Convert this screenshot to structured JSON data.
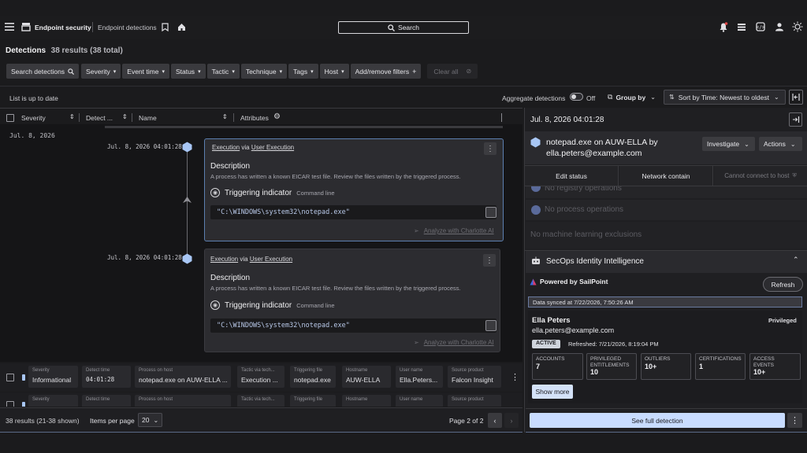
{
  "header": {
    "app_name": "Endpoint security",
    "section": "Endpoint detections",
    "search_label": "Search"
  },
  "title_bar": {
    "title": "Detections",
    "results": "38 results (38 total)"
  },
  "filters": {
    "search_detections": "Search detections",
    "severity": "Severity",
    "event_time": "Event time",
    "status": "Status",
    "tactic": "Tactic",
    "technique": "Technique",
    "tags": "Tags",
    "host": "Host",
    "add_remove": "Add/remove filters",
    "clear_all": "Clear all"
  },
  "toolbar": {
    "up_to_date": "List is up to date",
    "aggregate": "Aggregate detections",
    "aggregate_state": "Off",
    "group_by": "Group by",
    "sort_by": "Sort by Time: Newest to oldest"
  },
  "columns": {
    "severity": "Severity",
    "detect": "Detect ...",
    "name": "Name",
    "attributes": "Attributes"
  },
  "timeline": {
    "date": "Jul. 8, 2026",
    "events": [
      {
        "time": "Jul. 8, 2026 04:01:28",
        "technique": "Execution",
        "via": "via",
        "tactic": "User Execution",
        "desc_heading": "Description",
        "desc_text": "A process has written a known EICAR test file. Review the files written by the triggered process.",
        "indicator_label": "Triggering indicator",
        "indicator_type": "Command line",
        "command": "\"C:\\WINDOWS\\system32\\notepad.exe\"",
        "analyze": "Analyze with Charlotte AI"
      },
      {
        "time": "Jul. 8, 2026 04:01:28",
        "technique": "Execution",
        "via": "via",
        "tactic": "User Execution",
        "desc_heading": "Description",
        "desc_text": "A process has written a known EICAR test file. Review the files written by the triggered process.",
        "indicator_label": "Triggering indicator",
        "indicator_type": "Command line",
        "command": "\"C:\\WINDOWS\\system32\\notepad.exe\"",
        "analyze": "Analyze with Charlotte AI"
      }
    ]
  },
  "summary_row": {
    "cells": [
      {
        "k": "Severity",
        "v": "Informational"
      },
      {
        "k": "Detect time",
        "v": "04:01:28"
      },
      {
        "k": "Process on host",
        "v": "notepad.exe on AUW-ELLA ..."
      },
      {
        "k": "Tactic via tech...",
        "v": "Execution ..."
      },
      {
        "k": "Triggering file",
        "v": "notepad.exe"
      },
      {
        "k": "Hostname",
        "v": "AUW-ELLA"
      },
      {
        "k": "User name",
        "v": "Ella.Peters..."
      },
      {
        "k": "Source product",
        "v": "Falcon Insight"
      }
    ],
    "cells2": [
      {
        "k": "Severity"
      },
      {
        "k": "Detect time"
      },
      {
        "k": "Process on host"
      },
      {
        "k": "Tactic via tech..."
      },
      {
        "k": "Triggering file"
      },
      {
        "k": "Hostname"
      },
      {
        "k": "User name"
      },
      {
        "k": "Source product"
      }
    ]
  },
  "footer": {
    "shown": "38 results (21-38 shown)",
    "items_per_page": "Items per page",
    "per_page_value": "20",
    "page": "Page 2 of 2"
  },
  "panel": {
    "timestamp": "Jul. 8, 2026 04:01:28",
    "title_line1": "notepad.exe on AUW-ELLA by",
    "title_line2": "ella.peters@example.com",
    "investigate": "Investigate",
    "actions": "Actions",
    "edit_status": "Edit status",
    "network_contain": "Network contain",
    "cannot_connect": "Cannot connect to host",
    "no_registry": "No registry operations",
    "no_process": "No process operations",
    "no_ml": "No machine learning exclusions",
    "secops_title": "SecOps Identity Intelligence",
    "powered_by": "Powered by SailPoint",
    "refresh": "Refresh",
    "synced": "Data synced at 7/22/2026, 7:50:26 AM",
    "user_name": "Ella Peters",
    "user_email": "ella.peters@example.com",
    "privileged": "Privileged",
    "status_badge": "ACTIVE",
    "refreshed": "Refreshed: 7/21/2026, 8:19:04 PM",
    "stats": [
      {
        "k": "ACCOUNTS",
        "v": "7"
      },
      {
        "k": "PRIVILEGED ENTITLEMENTS",
        "v": "10"
      },
      {
        "k": "OUTLIERS",
        "v": "10+"
      },
      {
        "k": "CERTIFICATIONS",
        "v": "1"
      },
      {
        "k": "ACCESS EVENTS",
        "v": "10+"
      }
    ],
    "show_more": "Show more",
    "see_full": "See full detection"
  },
  "colors": {
    "accent_link": "#c8dcff",
    "node_blue": "#a8c6f4",
    "active_badge": "#cfd4dc"
  }
}
